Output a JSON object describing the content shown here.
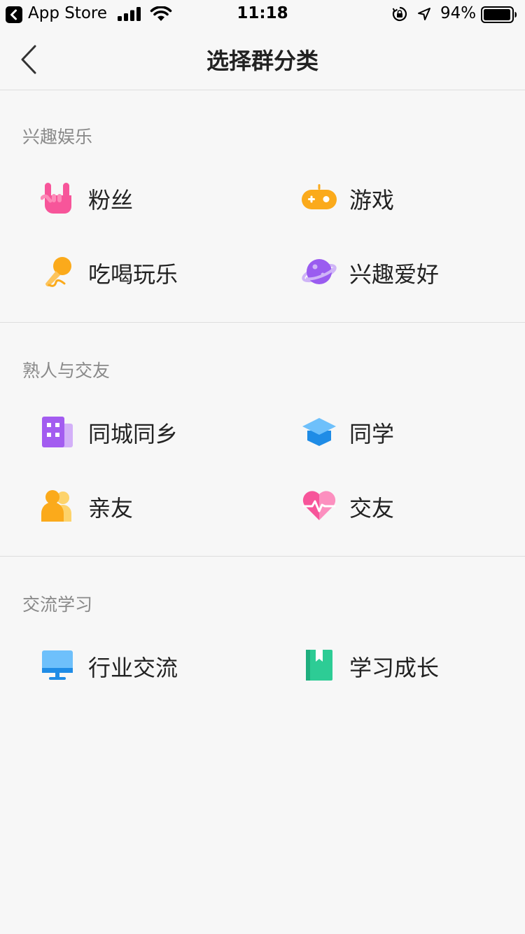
{
  "status_bar": {
    "carrier_app": "App Store",
    "time": "11:18",
    "battery_percent": "94%"
  },
  "nav": {
    "title": "选择群分类"
  },
  "sections": [
    {
      "title": "兴趣娱乐",
      "items": [
        {
          "label": "粉丝",
          "icon": "rock-hand-icon",
          "color": "#f7559a"
        },
        {
          "label": "游戏",
          "icon": "gamepad-icon",
          "color": "#fbaa1b"
        },
        {
          "label": "吃喝玩乐",
          "icon": "microphone-icon",
          "color": "#fbaa1b"
        },
        {
          "label": "兴趣爱好",
          "icon": "planet-icon",
          "color": "#9a5cf0"
        }
      ]
    },
    {
      "title": "熟人与交友",
      "items": [
        {
          "label": "同城同乡",
          "icon": "building-icon",
          "color": "#a35cf0"
        },
        {
          "label": "同学",
          "icon": "graduation-cap-icon",
          "color": "#46a4f7"
        },
        {
          "label": "亲友",
          "icon": "people-icon",
          "color": "#fbaa1b"
        },
        {
          "label": "交友",
          "icon": "heart-pulse-icon",
          "color": "#f7559a"
        }
      ]
    },
    {
      "title": "交流学习",
      "items": [
        {
          "label": "行业交流",
          "icon": "monitor-icon",
          "color": "#46a4f7"
        },
        {
          "label": "学习成长",
          "icon": "book-icon",
          "color": "#2dcc95"
        }
      ]
    }
  ]
}
